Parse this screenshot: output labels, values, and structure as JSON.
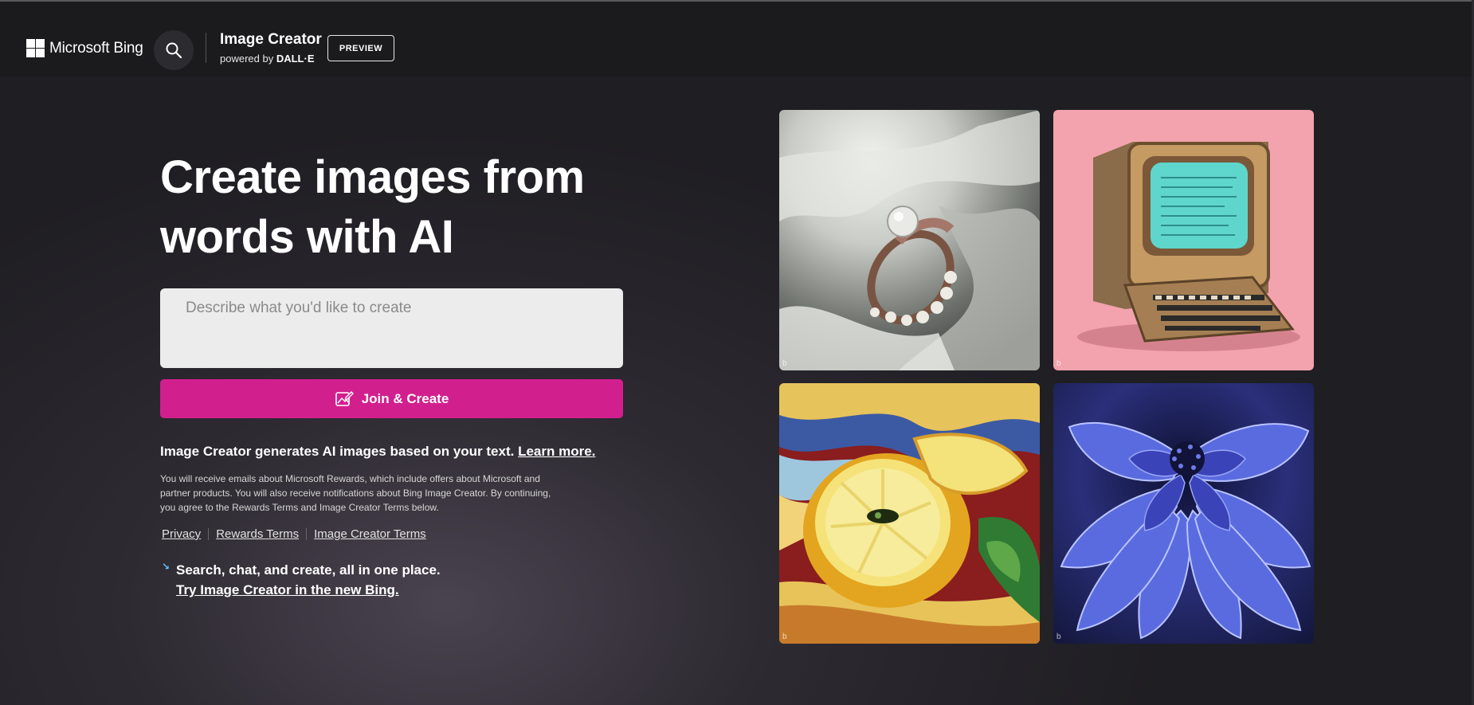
{
  "header": {
    "logo_text": "Microsoft Bing",
    "search_icon": "search-icon",
    "brand_title": "Image Creator",
    "brand_sub_prefix": "powered by ",
    "brand_sub_bold": "DALL·E",
    "preview_label": "PREVIEW"
  },
  "hero": {
    "title_line1": "Create images from",
    "title_line2": "words with AI"
  },
  "prompt": {
    "placeholder": "Describe what you'd like to create",
    "value": ""
  },
  "join_button": {
    "label": "Join & Create",
    "icon": "image-create-icon",
    "color": "#d21f8e"
  },
  "info": {
    "main_text": "Image Creator generates AI images based on your text. ",
    "learn_more": "Learn more.",
    "small_text": "You will receive emails about Microsoft Rewards, which include offers about Microsoft and partner products. You will also receive notifications about Bing Image Creator. By continuing, you agree to the Rewards Terms and Image Creator Terms below."
  },
  "links": {
    "privacy": "Privacy",
    "rewards_terms": "Rewards Terms",
    "image_creator_terms": "Image Creator Terms"
  },
  "new_bing": {
    "headline": "Search, chat, and create, all in one place.",
    "link": "Try Image Creator in the new Bing."
  },
  "gallery": [
    {
      "subject": "pearl ring on silk"
    },
    {
      "subject": "vintage computer on pink"
    },
    {
      "subject": "lemon painting"
    },
    {
      "subject": "blue dahlia flower"
    }
  ]
}
